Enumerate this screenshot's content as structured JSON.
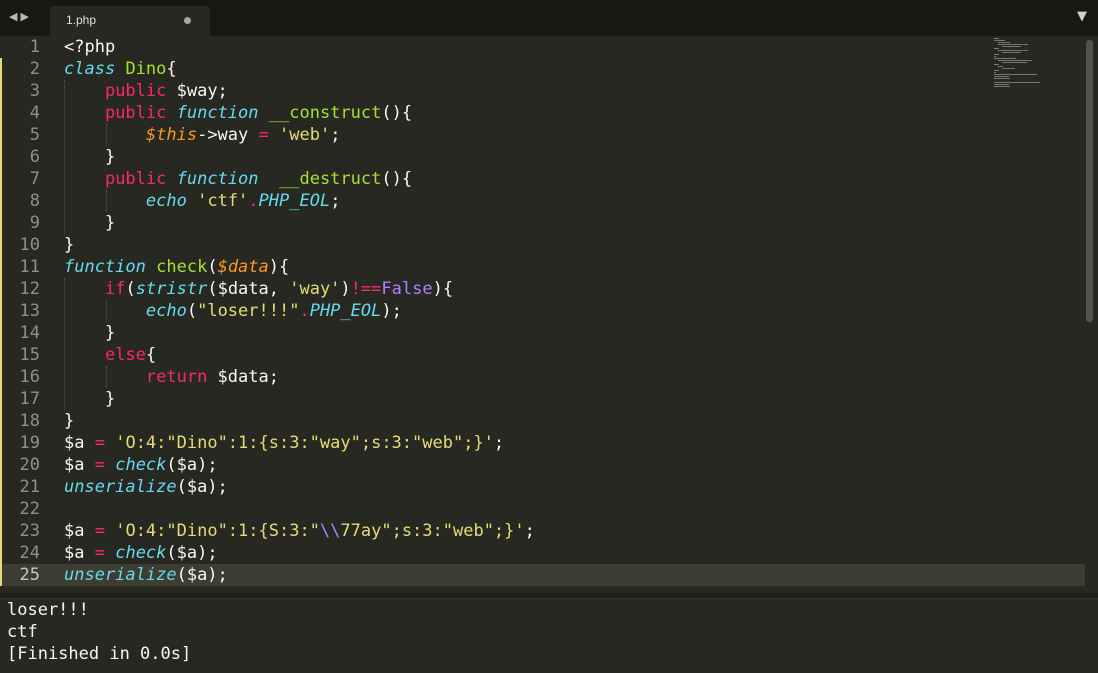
{
  "tab": {
    "name": "1.php"
  },
  "lines": [
    {
      "n": "1",
      "tokens": [
        {
          "c": "",
          "t": "<?php"
        }
      ]
    },
    {
      "n": "2",
      "tokens": [
        {
          "c": "t",
          "t": "class"
        },
        {
          "c": "",
          "t": " "
        },
        {
          "c": "f",
          "t": "Dino"
        },
        {
          "c": "",
          "t": "{"
        }
      ]
    },
    {
      "n": "3",
      "tokens": [
        {
          "c": "",
          "t": "    "
        },
        {
          "c": "k",
          "t": "public"
        },
        {
          "c": "",
          "t": " $way;"
        }
      ]
    },
    {
      "n": "4",
      "tokens": [
        {
          "c": "",
          "t": "    "
        },
        {
          "c": "k",
          "t": "public"
        },
        {
          "c": "",
          "t": " "
        },
        {
          "c": "t",
          "t": "function"
        },
        {
          "c": "",
          "t": " "
        },
        {
          "c": "f",
          "t": "__construct"
        },
        {
          "c": "",
          "t": "(){"
        }
      ]
    },
    {
      "n": "5",
      "tokens": [
        {
          "c": "",
          "t": "        "
        },
        {
          "c": "v",
          "t": "$this"
        },
        {
          "c": "",
          "t": "->way "
        },
        {
          "c": "k",
          "t": "="
        },
        {
          "c": "",
          "t": " "
        },
        {
          "c": "s",
          "t": "'web'"
        },
        {
          "c": "",
          "t": ";"
        }
      ]
    },
    {
      "n": "6",
      "tokens": [
        {
          "c": "",
          "t": "    }"
        }
      ]
    },
    {
      "n": "7",
      "tokens": [
        {
          "c": "",
          "t": "    "
        },
        {
          "c": "k",
          "t": "public"
        },
        {
          "c": "",
          "t": " "
        },
        {
          "c": "t",
          "t": "function"
        },
        {
          "c": "",
          "t": "  "
        },
        {
          "c": "f",
          "t": "__destruct"
        },
        {
          "c": "",
          "t": "(){"
        }
      ]
    },
    {
      "n": "8",
      "tokens": [
        {
          "c": "",
          "t": "        "
        },
        {
          "c": "t",
          "t": "echo"
        },
        {
          "c": "",
          "t": " "
        },
        {
          "c": "s",
          "t": "'ctf'"
        },
        {
          "c": "k",
          "t": "."
        },
        {
          "c": "t",
          "t": "PHP_EOL"
        },
        {
          "c": "",
          "t": ";"
        }
      ]
    },
    {
      "n": "9",
      "tokens": [
        {
          "c": "",
          "t": "    }"
        }
      ]
    },
    {
      "n": "10",
      "tokens": [
        {
          "c": "",
          "t": "}"
        }
      ]
    },
    {
      "n": "11",
      "tokens": [
        {
          "c": "t",
          "t": "function"
        },
        {
          "c": "",
          "t": " "
        },
        {
          "c": "f",
          "t": "check"
        },
        {
          "c": "",
          "t": "("
        },
        {
          "c": "v",
          "t": "$data"
        },
        {
          "c": "",
          "t": "){"
        }
      ]
    },
    {
      "n": "12",
      "tokens": [
        {
          "c": "",
          "t": "    "
        },
        {
          "c": "k",
          "t": "if"
        },
        {
          "c": "",
          "t": "("
        },
        {
          "c": "t",
          "t": "stristr"
        },
        {
          "c": "",
          "t": "($data, "
        },
        {
          "c": "s",
          "t": "'way'"
        },
        {
          "c": "",
          "t": ")"
        },
        {
          "c": "k",
          "t": "!=="
        },
        {
          "c": "c",
          "t": "False"
        },
        {
          "c": "",
          "t": "){"
        }
      ]
    },
    {
      "n": "13",
      "tokens": [
        {
          "c": "",
          "t": "        "
        },
        {
          "c": "t",
          "t": "echo"
        },
        {
          "c": "",
          "t": "("
        },
        {
          "c": "s",
          "t": "\"loser!!!\""
        },
        {
          "c": "k",
          "t": "."
        },
        {
          "c": "t",
          "t": "PHP_EOL"
        },
        {
          "c": "",
          "t": ");"
        }
      ]
    },
    {
      "n": "14",
      "tokens": [
        {
          "c": "",
          "t": "    }"
        }
      ]
    },
    {
      "n": "15",
      "tokens": [
        {
          "c": "",
          "t": "    "
        },
        {
          "c": "k",
          "t": "else"
        },
        {
          "c": "",
          "t": "{"
        }
      ]
    },
    {
      "n": "16",
      "tokens": [
        {
          "c": "",
          "t": "        "
        },
        {
          "c": "k",
          "t": "return"
        },
        {
          "c": "",
          "t": " $data;"
        }
      ]
    },
    {
      "n": "17",
      "tokens": [
        {
          "c": "",
          "t": "    }"
        }
      ]
    },
    {
      "n": "18",
      "tokens": [
        {
          "c": "",
          "t": "}"
        }
      ]
    },
    {
      "n": "19",
      "tokens": [
        {
          "c": "",
          "t": "$a "
        },
        {
          "c": "k",
          "t": "="
        },
        {
          "c": "",
          "t": " "
        },
        {
          "c": "s",
          "t": "'O:4:\"Dino\":1:{s:3:\"way\";s:3:\"web\";}'"
        },
        {
          "c": "",
          "t": ";"
        }
      ]
    },
    {
      "n": "20",
      "tokens": [
        {
          "c": "",
          "t": "$a "
        },
        {
          "c": "k",
          "t": "="
        },
        {
          "c": "",
          "t": " "
        },
        {
          "c": "t",
          "t": "check"
        },
        {
          "c": "",
          "t": "($a);"
        }
      ]
    },
    {
      "n": "21",
      "tokens": [
        {
          "c": "t",
          "t": "unserialize"
        },
        {
          "c": "",
          "t": "($a);"
        }
      ]
    },
    {
      "n": "22",
      "tokens": []
    },
    {
      "n": "23",
      "tokens": [
        {
          "c": "",
          "t": "$a "
        },
        {
          "c": "k",
          "t": "="
        },
        {
          "c": "",
          "t": " "
        },
        {
          "c": "s",
          "t": "'O:4:\"Dino\":1:{S:3:\""
        },
        {
          "c": "c",
          "t": "\\\\"
        },
        {
          "c": "s",
          "t": "77ay\";s:3:\"web\";}'"
        },
        {
          "c": "",
          "t": ";"
        }
      ]
    },
    {
      "n": "24",
      "tokens": [
        {
          "c": "",
          "t": "$a "
        },
        {
          "c": "k",
          "t": "="
        },
        {
          "c": "",
          "t": " "
        },
        {
          "c": "t",
          "t": "check"
        },
        {
          "c": "",
          "t": "($a);"
        }
      ]
    },
    {
      "n": "25",
      "tokens": [
        {
          "c": "t",
          "t": "unserialize"
        },
        {
          "c": "",
          "t": "($a);"
        }
      ]
    }
  ],
  "output": [
    "loser!!!",
    "ctf",
    "[Finished in 0.0s]"
  ],
  "colors": {
    "background": "#272822",
    "keyword": "#f92672",
    "string": "#e6db74",
    "function": "#a6e22e",
    "type": "#66d9ef",
    "variable": "#fd971f",
    "constant": "#ae81ff"
  },
  "icons": {
    "nav": "left-right-arrows-icon",
    "dirty": "unsaved-dot-icon",
    "menu": "dropdown-arrow-icon"
  }
}
